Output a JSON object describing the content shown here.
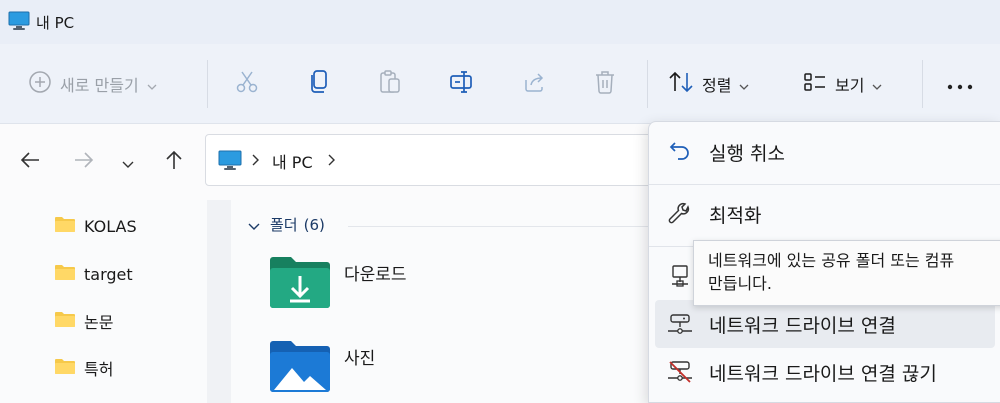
{
  "window": {
    "title": "내 PC",
    "icon": "monitor-icon"
  },
  "toolbar": {
    "new_label": "새로 만들기",
    "sort_label": "정렬",
    "view_label": "보기",
    "icons": [
      "plus-circle-icon",
      "cut-icon",
      "copy-icon",
      "paste-icon",
      "rename-icon",
      "share-icon",
      "delete-icon",
      "sort-icon",
      "view-icon",
      "more-icon"
    ]
  },
  "address": {
    "crumbs": [
      "내 PC"
    ]
  },
  "sidebar": {
    "items": [
      {
        "label": "KOLAS"
      },
      {
        "label": "target"
      },
      {
        "label": "논문"
      },
      {
        "label": "특허"
      }
    ]
  },
  "main": {
    "section_title": "폴더",
    "section_count": "(6)",
    "folders": [
      {
        "label": "다운로드",
        "icon": "downloads-folder-icon"
      },
      {
        "label": "사진",
        "icon": "pictures-folder-icon"
      }
    ]
  },
  "menu": {
    "items": [
      {
        "label": "실행 취소",
        "icon": "undo-icon"
      },
      {
        "label": "최적화",
        "icon": "wrench-icon"
      },
      {
        "label": "",
        "icon": "network-location-icon"
      },
      {
        "label": "네트워크 드라이브 연결",
        "icon": "map-network-drive-icon"
      },
      {
        "label": "네트워크 드라이브 연결 끊기",
        "icon": "disconnect-network-drive-icon"
      }
    ]
  },
  "tooltip": {
    "line1": "네트워크에 있는 공유 폴더 또는 컴퓨",
    "line2": "만듭니다."
  },
  "colors": {
    "accent": "#0a59c8",
    "folder_yellow": "#f6c94a",
    "downloads_green": "#1f9e78",
    "pictures_blue": "#1c7ad6"
  }
}
